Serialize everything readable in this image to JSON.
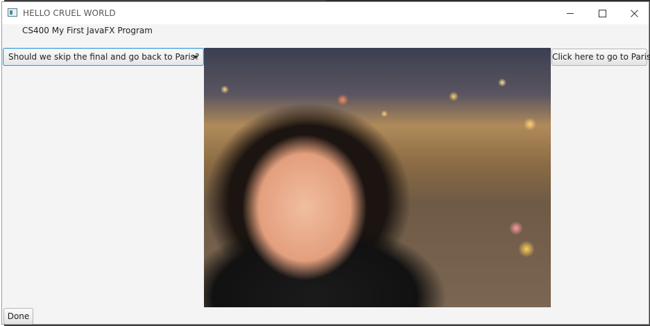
{
  "window": {
    "title": "HELLO CRUEL WORLD"
  },
  "header": {
    "label": "CS400 My First JavaFX Program"
  },
  "combo": {
    "selected": "Should we skip the final and go back to Paris?"
  },
  "buttons": {
    "go_paris": "Click here to go to Paris",
    "done": "Done"
  },
  "photo": {
    "icon": "photo-of-person-in-paris"
  },
  "colors": {
    "focus_accent": "#3a9bdc",
    "window_bg": "#f4f4f4"
  }
}
